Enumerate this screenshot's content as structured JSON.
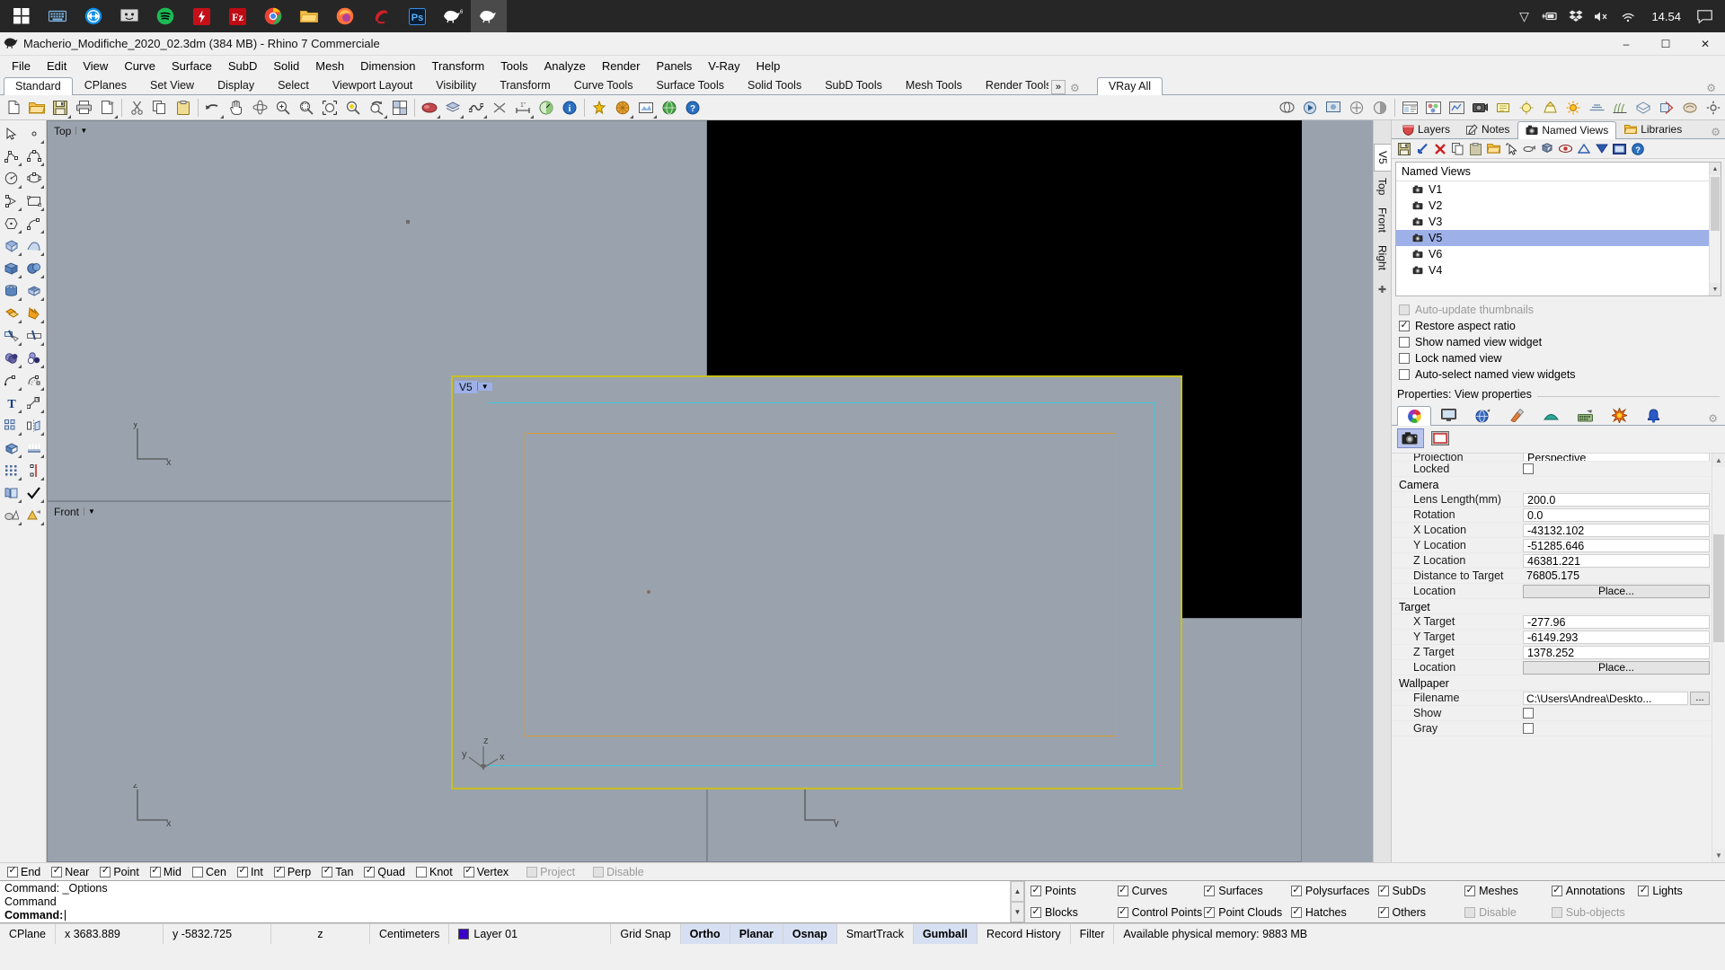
{
  "taskbar": {
    "icons": [
      "windows-start-icon",
      "keyboard-icon",
      "teamviewer-icon",
      "remote-desktop-icon",
      "spotify-icon",
      "flash-icon",
      "filezilla-icon",
      "chrome-icon",
      "file-explorer-icon",
      "firefox-icon",
      "sketchup-icon",
      "photoshop-icon",
      "rhino-6-icon",
      "rhino-7-icon"
    ],
    "tray": {
      "chevron": "chevron-up-icon",
      "power": "battery-icon",
      "dropbox": "dropbox-icon",
      "volume": "volume-muted-icon",
      "wifi": "wifi-icon",
      "clock": "14.54",
      "action_center": "action-center-icon"
    }
  },
  "titlebar": {
    "icon": "rhino-logo-icon",
    "title": "Macherio_Modifiche_2020_02.3dm (384 MB) - Rhino 7 Commerciale",
    "minimize": "–",
    "maximize": "☐",
    "close": "✕"
  },
  "menubar": {
    "items": [
      "File",
      "Edit",
      "View",
      "Curve",
      "Surface",
      "SubD",
      "Solid",
      "Mesh",
      "Dimension",
      "Transform",
      "Tools",
      "Analyze",
      "Render",
      "Panels",
      "V-Ray",
      "Help"
    ]
  },
  "toolbar_tabs": {
    "items": [
      "Standard",
      "CPlanes",
      "Set View",
      "Display",
      "Select",
      "Viewport Layout",
      "Visibility",
      "Transform",
      "Curve Tools",
      "Surface Tools",
      "Solid Tools",
      "SubD Tools",
      "Mesh Tools",
      "Render Tools"
    ],
    "active": "Standard",
    "overflow": "»",
    "gear": "gear-icon",
    "right_tab": "VRay All",
    "far_gear": "gear-icon"
  },
  "viewports": {
    "top": {
      "label": "Top",
      "active": false
    },
    "front": {
      "label": "Front",
      "active": false
    },
    "v5": {
      "label": "V5",
      "active": true
    },
    "axis_labels": {
      "x": "x",
      "y": "y",
      "z": "z"
    },
    "right_tabs": [
      "V5",
      "Top",
      "Front",
      "Right"
    ],
    "right_tabs_active": "V5"
  },
  "panel": {
    "tabs": [
      {
        "label": "Layers",
        "icon": "layers-icon",
        "active": false
      },
      {
        "label": "Notes",
        "icon": "notes-icon",
        "active": false
      },
      {
        "label": "Named Views",
        "icon": "camera-icon",
        "active": true
      },
      {
        "label": "Libraries",
        "icon": "folder-icon",
        "active": false
      }
    ],
    "gear": "gear-icon",
    "toolbar_icons": [
      "save-icon",
      "restore-view-icon",
      "delete-icon",
      "copy-icon",
      "paste-icon",
      "open-folder-icon",
      "select-icon",
      "edit-icon",
      "duplicate-icon",
      "visibility-icon",
      "move-up-icon",
      "move-down-icon",
      "thumbnail-icon",
      "help-icon"
    ],
    "named_views": {
      "header": "Named Views",
      "items": [
        {
          "name": "V1",
          "selected": false
        },
        {
          "name": "V2",
          "selected": false
        },
        {
          "name": "V3",
          "selected": false
        },
        {
          "name": "V5",
          "selected": true
        },
        {
          "name": "V6",
          "selected": false
        },
        {
          "name": "V4",
          "selected": false
        }
      ]
    },
    "options": [
      {
        "label": "Auto-update thumbnails",
        "checked": false,
        "disabled": true
      },
      {
        "label": "Restore aspect ratio",
        "checked": true,
        "disabled": false
      },
      {
        "label": "Show named view widget",
        "checked": false,
        "disabled": false
      },
      {
        "label": "Lock named view",
        "checked": false,
        "disabled": false
      },
      {
        "label": "Auto-select named view widgets",
        "checked": false,
        "disabled": false
      }
    ]
  },
  "properties": {
    "header": "Properties: View properties",
    "tabs": [
      "color-wheel-icon",
      "display-icon",
      "environment-icon",
      "material-icon",
      "ground-plane-icon",
      "render-icon",
      "sun-icon",
      "notification-icon"
    ],
    "tabs_gear": "gear-icon",
    "subtabs": [
      {
        "icon": "camera-icon",
        "active": true
      },
      {
        "icon": "wallpaper-icon",
        "active": false
      }
    ],
    "rows": [
      {
        "label": "Projection",
        "value": "Perspective",
        "type": "dropdown",
        "clipped": true
      },
      {
        "label": "Locked",
        "value": "",
        "type": "checkbox",
        "checked": false
      },
      {
        "section": "Camera"
      },
      {
        "label": "Lens Length(mm)",
        "value": "200.0",
        "type": "text"
      },
      {
        "label": "Rotation",
        "value": "0.0",
        "type": "text"
      },
      {
        "label": "X Location",
        "value": "-43132.102",
        "type": "text"
      },
      {
        "label": "Y Location",
        "value": "-51285.646",
        "type": "text"
      },
      {
        "label": "Z Location",
        "value": "46381.221",
        "type": "text"
      },
      {
        "label": "Distance to Target",
        "value": "76805.175",
        "type": "readonly"
      },
      {
        "label": "Location",
        "value": "Place...",
        "type": "button"
      },
      {
        "section": "Target"
      },
      {
        "label": "X Target",
        "value": "-277.96",
        "type": "text"
      },
      {
        "label": "Y Target",
        "value": "-6149.293",
        "type": "text"
      },
      {
        "label": "Z Target",
        "value": "1378.252",
        "type": "text"
      },
      {
        "label": "Location",
        "value": "Place...",
        "type": "button"
      },
      {
        "section": "Wallpaper"
      },
      {
        "label": "Filename",
        "value": "C:\\Users\\Andrea\\Deskto...",
        "type": "file",
        "browse": "..."
      },
      {
        "label": "Show",
        "value": "",
        "type": "checkbox",
        "checked": false
      },
      {
        "label": "Gray",
        "value": "",
        "type": "checkbox",
        "checked": false
      }
    ]
  },
  "osnap": [
    {
      "label": "End",
      "checked": true,
      "disabled": false
    },
    {
      "label": "Near",
      "checked": true,
      "disabled": false
    },
    {
      "label": "Point",
      "checked": true,
      "disabled": false
    },
    {
      "label": "Mid",
      "checked": true,
      "disabled": false
    },
    {
      "label": "Cen",
      "checked": false,
      "disabled": false
    },
    {
      "label": "Int",
      "checked": true,
      "disabled": false
    },
    {
      "label": "Perp",
      "checked": true,
      "disabled": false
    },
    {
      "label": "Tan",
      "checked": true,
      "disabled": false
    },
    {
      "label": "Quad",
      "checked": true,
      "disabled": false
    },
    {
      "label": "Knot",
      "checked": false,
      "disabled": false
    },
    {
      "label": "Vertex",
      "checked": true,
      "disabled": false
    },
    {
      "label": "Project",
      "checked": false,
      "disabled": true
    },
    {
      "label": "Disable",
      "checked": false,
      "disabled": true
    }
  ],
  "command": {
    "line1": "Command: _Options",
    "line2": "Command",
    "prompt": "Command:",
    "input_value": ""
  },
  "filters": [
    {
      "label": "Points",
      "checked": true,
      "disabled": false
    },
    {
      "label": "Curves",
      "checked": true,
      "disabled": false
    },
    {
      "label": "Surfaces",
      "checked": true,
      "disabled": false
    },
    {
      "label": "Polysurfaces",
      "checked": true,
      "disabled": false
    },
    {
      "label": "SubDs",
      "checked": true,
      "disabled": false
    },
    {
      "label": "Meshes",
      "checked": true,
      "disabled": false
    },
    {
      "label": "Annotations",
      "checked": true,
      "disabled": false
    },
    {
      "label": "Lights",
      "checked": true,
      "disabled": false
    },
    {
      "label": "Blocks",
      "checked": true,
      "disabled": false
    },
    {
      "label": "Control Points",
      "checked": true,
      "disabled": false
    },
    {
      "label": "Point Clouds",
      "checked": true,
      "disabled": false
    },
    {
      "label": "Hatches",
      "checked": true,
      "disabled": false
    },
    {
      "label": "Others",
      "checked": true,
      "disabled": false
    },
    {
      "label": "Disable",
      "checked": false,
      "disabled": true
    },
    {
      "label": "Sub-objects",
      "checked": false,
      "disabled": true
    }
  ],
  "statusbar": {
    "cplane": "CPlane",
    "x": "x 3683.889",
    "y": "y -5832.725",
    "z": "z",
    "units": "Centimeters",
    "layer": "Layer 01",
    "layer_color": "#3a00c8",
    "toggles": [
      {
        "label": "Grid Snap",
        "on": false
      },
      {
        "label": "Ortho",
        "on": true
      },
      {
        "label": "Planar",
        "on": true
      },
      {
        "label": "Osnap",
        "on": true
      },
      {
        "label": "SmartTrack",
        "on": false
      },
      {
        "label": "Gumball",
        "on": true
      },
      {
        "label": "Record History",
        "on": false
      },
      {
        "label": "Filter",
        "on": false
      }
    ],
    "memory": "Available physical memory: 9883 MB"
  },
  "colors": {
    "viewport_bg": "#9aa3ad",
    "active_border": "#c8c020",
    "cyan_rect": "#3dc8dc",
    "orange_rect": "#d99b33",
    "black_area": "#000000",
    "selection_blue": "#9eb0e8"
  }
}
